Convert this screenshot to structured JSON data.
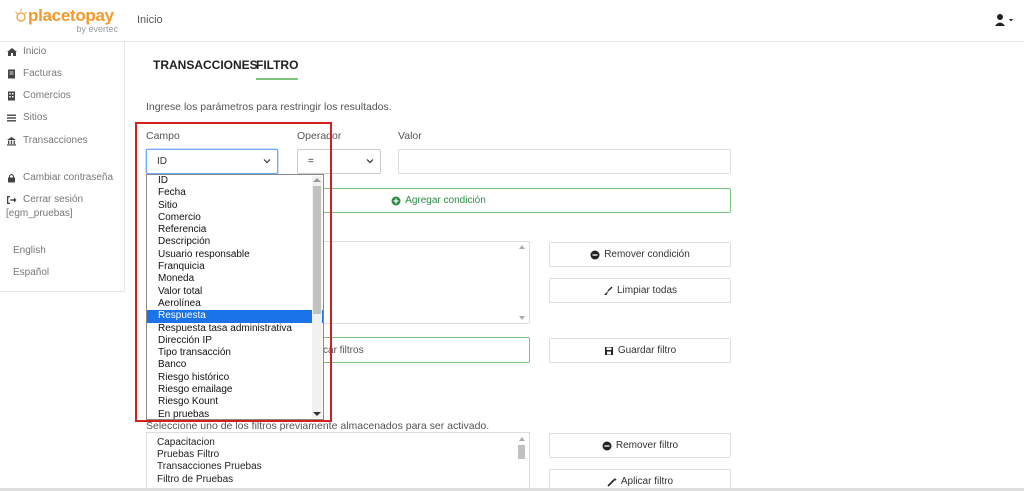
{
  "header": {
    "logo_text": "placetopay",
    "logo_sub": "by evertec",
    "title": "Inicio"
  },
  "sidebar": {
    "items": [
      {
        "label": "Inicio",
        "icon": "home-icon"
      },
      {
        "label": "Facturas",
        "icon": "invoice-icon"
      },
      {
        "label": "Comercios",
        "icon": "building-icon"
      },
      {
        "label": "Sitios",
        "icon": "list-icon"
      },
      {
        "label": "Transacciones",
        "icon": "bank-icon"
      },
      {
        "label": "Cambiar contraseña",
        "icon": "lock-icon"
      },
      {
        "label": "Cerrar sesión",
        "icon": "logout-icon"
      }
    ],
    "user": "[egm_pruebas]",
    "languages": [
      "English",
      "Español"
    ]
  },
  "tabs": [
    "TRANSACCIONES",
    "FILTRO"
  ],
  "active_tab": "FILTRO",
  "intro": "Ingrese los parámetros para restringir los resultados.",
  "form": {
    "campo_label": "Campo",
    "operador_label": "Operador",
    "valor_label": "Valor",
    "campo_value": "ID",
    "operador_value": "=",
    "valor_value": ""
  },
  "buttons": {
    "agregar": "Agregar condición",
    "remover_condicion": "Remover condición",
    "limpiar": "Limpiar todas",
    "aplicar_filtros": "plicar filtros",
    "guardar": "Guardar filtro",
    "remover_filtro": "Remover filtro",
    "aplicar_filtro": "Aplicar filtro"
  },
  "dropdown_options": [
    "ID",
    "Fecha",
    "Sitio",
    "Comercio",
    "Referencia",
    "Descripción",
    "Usuario responsable",
    "Franquicia",
    "Moneda",
    "Valor total",
    "Aerolínea",
    "Respuesta",
    "Respuesta tasa administrativa",
    "Dirección IP",
    "Tipo transacción",
    "Banco",
    "Riesgo histórico",
    "Riesgo emailage",
    "Riesgo Kount",
    "En pruebas"
  ],
  "dropdown_selected": "Respuesta",
  "saved": {
    "intro": "Seleccione uno de los filtros previamente almacenados para ser activado.",
    "items": [
      "Capacitacion",
      "Pruebas Filtro",
      "Transacciones Pruebas",
      "Filtro de Pruebas"
    ]
  },
  "colors": {
    "brand": "#f39a2b",
    "accent_green": "#7cc47e",
    "selection_blue": "#1a73e8",
    "highlight_red": "#d41f1f"
  }
}
